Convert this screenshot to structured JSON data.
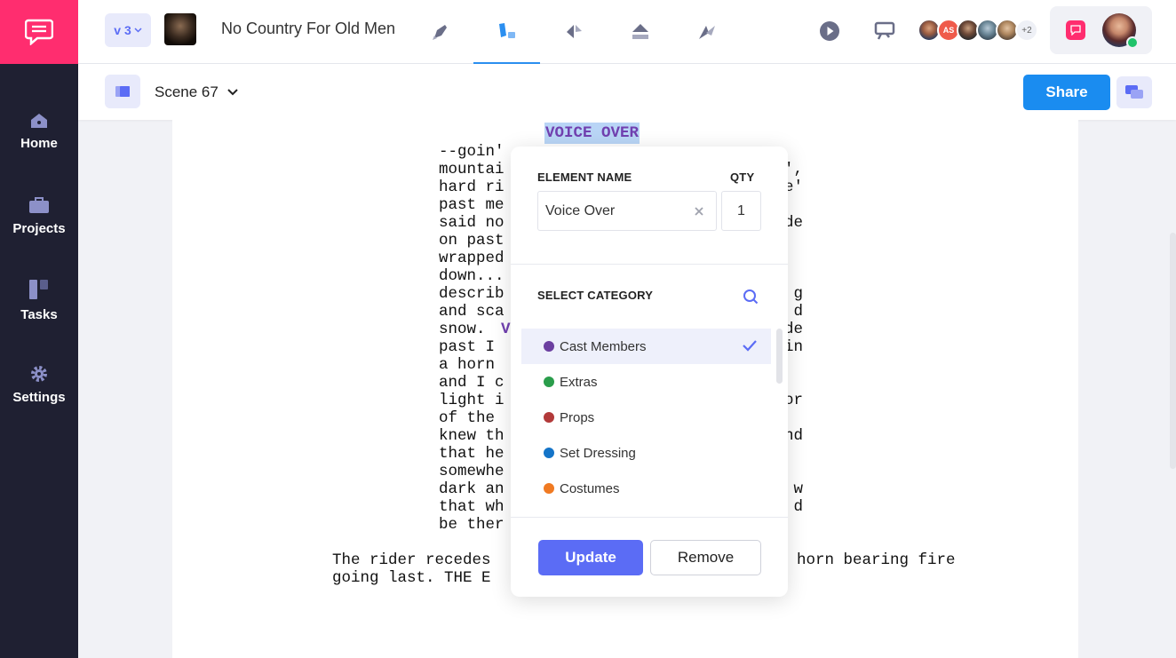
{
  "app": {
    "accent": "#5b6cf5",
    "brand": "#ff2d6f"
  },
  "sidebar": {
    "items": [
      {
        "label": "Home",
        "icon": "home-icon"
      },
      {
        "label": "Projects",
        "icon": "briefcase-icon"
      },
      {
        "label": "Tasks",
        "icon": "tasks-icon"
      },
      {
        "label": "Settings",
        "icon": "gear-icon"
      }
    ]
  },
  "topbar": {
    "version": "v 3",
    "project_title": "No Country For Old Men",
    "tools": [
      "pencil-icon",
      "breakdown-icon",
      "schedule-icon",
      "storyboard-icon",
      "shotlist-icon"
    ],
    "active_tool": "breakdown-icon",
    "collaborator_initials": "AS",
    "collaborators_more": "+2"
  },
  "subbar": {
    "scene": "Scene 67",
    "share_label": "Share"
  },
  "script": {
    "character": "VOICE OVER",
    "dialogue_lines": [
      "--goin' ",
      "mountai",
      "hard ri",
      "past me",
      "said no",
      "on past",
      "wrapped",
      "down...",
      "describ",
      "and sca",
      "snow.",
      "past I",
      "a horn",
      "and I c",
      "light i",
      "of the",
      "knew th",
      "that he",
      "somewhe",
      "dark an",
      "that wh",
      "be ther"
    ],
    "dialogue_right": [
      "",
      "',",
      "e'",
      "",
      "de",
      "",
      "",
      "",
      "g",
      "d",
      "de",
      "in",
      "",
      "",
      "or",
      "",
      "nd",
      "",
      "",
      "w",
      "d",
      ""
    ],
    "inline_highlight": "V",
    "action_line1": "The rider recedes",
    "action_line1_right": "horn bearing fire",
    "action_line2": "going last. THE E"
  },
  "popup": {
    "element_name_label": "ELEMENT NAME",
    "qty_label": "QTY",
    "element_name_value": "Voice Over",
    "qty_value": "1",
    "select_category_label": "SELECT CATEGORY",
    "categories": [
      {
        "label": "Cast Members",
        "color": "#6b3fa0",
        "selected": true
      },
      {
        "label": "Extras",
        "color": "#2a9d4b",
        "selected": false
      },
      {
        "label": "Props",
        "color": "#b23a3a",
        "selected": false
      },
      {
        "label": "Set Dressing",
        "color": "#1474c8",
        "selected": false
      },
      {
        "label": "Costumes",
        "color": "#f07a22",
        "selected": false
      }
    ],
    "update_label": "Update",
    "remove_label": "Remove"
  }
}
